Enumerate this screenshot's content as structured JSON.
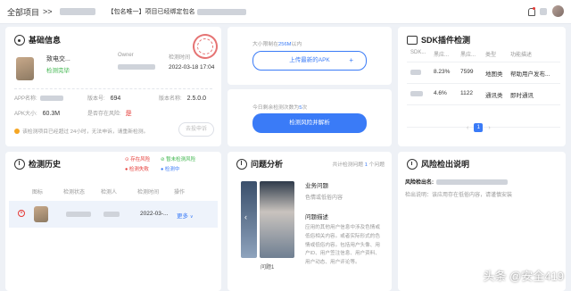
{
  "topbar": {
    "crumb_root": "全部项目",
    "crumb_sep": ">>",
    "notice": "【包名唯一】项目已经绑定包名"
  },
  "basic": {
    "title": "基础信息",
    "app_name_short": "致电交...",
    "status": "检测完毕",
    "owner_label": "Owner",
    "time_label": "检测时间",
    "time_value": "2022-03-18 17:04",
    "app_name_label": "APP名称:",
    "version_no_label": "版本号:",
    "version_no": "694",
    "version_name_label": "版本名称:",
    "version_name": "2.5.0.0",
    "size_label": "APK大小:",
    "size": "60.3M",
    "risk_label": "是否存在风险:",
    "risk": "是",
    "hint": "该检测项目已经超过 24小时，无法申诉，请重新检测。",
    "appeal": "去投申诉"
  },
  "upload": {
    "limit_prefix": "大小限制在",
    "limit_value": "256M",
    "limit_suffix": "以内",
    "upload_btn": "上传最新的APK",
    "remain_prefix": "今日剩余检测次数为",
    "remain_value": "5",
    "remain_suffix": "次",
    "detect_btn": "检测风险并解析"
  },
  "sdk": {
    "title": "SDK插件检测",
    "headers": [
      "SDK...",
      "黑应...",
      "黑应...",
      "类型",
      "功能描述"
    ],
    "rows": [
      {
        "pct": "8.23%",
        "count": "7599",
        "type": "地图类",
        "desc": "帮助用户发布..."
      },
      {
        "pct": "4.6%",
        "count": "1122",
        "type": "通讯类",
        "desc": "即时通讯"
      }
    ],
    "page": "1"
  },
  "history": {
    "title": "检测历史",
    "legend": [
      {
        "text": "存在风险",
        "color": "#e53935"
      },
      {
        "text": "暂未检测风险",
        "color": "#3bb44a"
      },
      {
        "text": "检测失败",
        "color": "#e53935"
      },
      {
        "text": "检测中",
        "color": "#3a7bf7"
      }
    ],
    "headers": [
      "图标",
      "检测状态",
      "检测人",
      "检测时间",
      "操作"
    ],
    "row_time": "2022-03-...",
    "more": "更多"
  },
  "issues": {
    "title": "问题分析",
    "count_prefix": "共计检测问题",
    "count": "1",
    "count_suffix": "个问题",
    "biz_title": "业务问题",
    "biz_desc": "色情或低俗内容",
    "desc_title": "问题描述",
    "desc_text": "应用的其他用户信息中涉及色情或低俗相关内容。或者实际形式的色情或低俗内容。包括用户头像、用户ID、用户签注信息、用户资料、用户动态、用户评论等。",
    "thumb_label": "问题1"
  },
  "risk": {
    "title": "风险检出说明",
    "name_label": "风险检出名:",
    "advice_label": "检出说明：",
    "advice": "该应用存在低俗内容，请谨慎安装"
  },
  "watermark": "头条 @安全419"
}
